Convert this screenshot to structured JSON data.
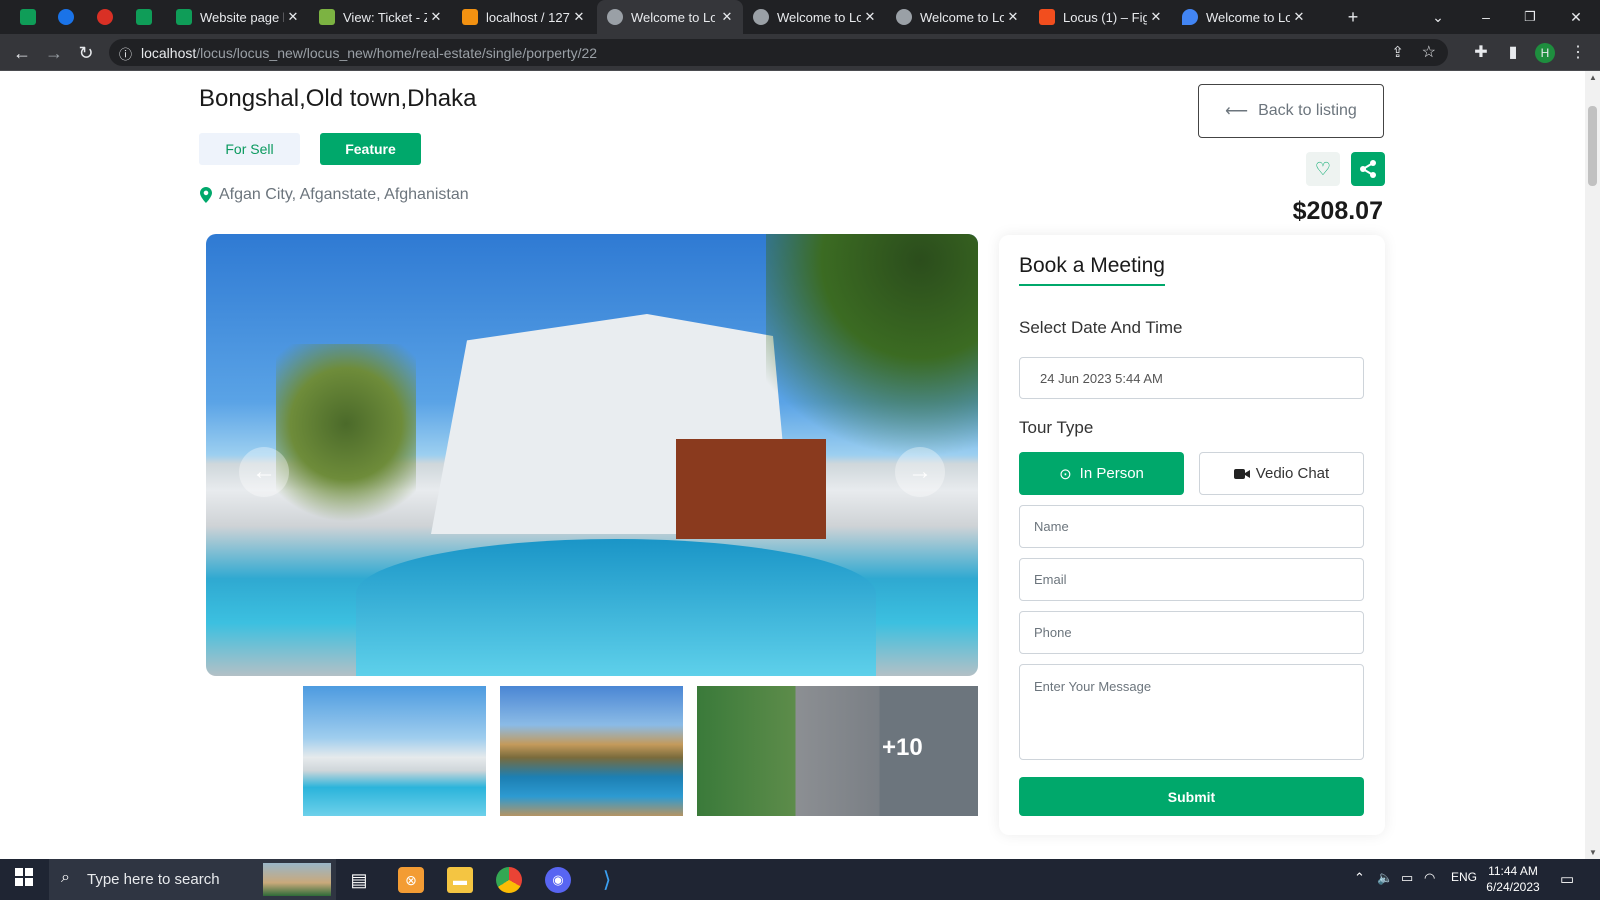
{
  "browser": {
    "tabs": [
      {
        "title": "",
        "favicon_color": "#0f9d58"
      },
      {
        "title": "",
        "favicon_color": "#1a73e8"
      },
      {
        "title": "",
        "favicon_color": "#d93025"
      },
      {
        "title": "",
        "favicon_color": "#0f9d58"
      },
      {
        "title": "Website page li",
        "favicon_color": "#0f9d58"
      },
      {
        "title": "View: Ticket - Z",
        "favicon_color": "#7cb342"
      },
      {
        "title": "localhost / 127.",
        "favicon_color": "#f29111"
      },
      {
        "title": "Welcome to Lo",
        "favicon_color": "#9aa0a6",
        "active": true
      },
      {
        "title": "Welcome to Lo",
        "favicon_color": "#9aa0a6"
      },
      {
        "title": "Welcome to Lo",
        "favicon_color": "#9aa0a6"
      },
      {
        "title": "Locus (1) – Figm",
        "favicon_color": "#f24e1e"
      },
      {
        "title": "Welcome to Lo",
        "favicon_color": "#4285f4"
      }
    ],
    "url_host": "localhost",
    "url_path": "/locus/locus_new/locus_new/home/real-estate/single/porperty/22",
    "profile_initial": "H"
  },
  "property": {
    "title": "Bongshal,Old town,Dhaka",
    "badge_sell": "For Sell",
    "badge_feature": "Feature",
    "location": "Afgan City, Afganstate, Afghanistan",
    "back_label": "Back to listing",
    "price": "$208.07",
    "more_photos": "+10"
  },
  "booking": {
    "title": "Book a Meeting",
    "date_label": "Select Date And Time",
    "date_value": "24 Jun 2023 5:44 AM",
    "tour_label": "Tour Type",
    "in_person": "In Person",
    "video_chat": "Vedio Chat",
    "name_placeholder": "Name",
    "email_placeholder": "Email",
    "phone_placeholder": "Phone",
    "message_placeholder": "Enter Your Message",
    "submit": "Submit"
  },
  "taskbar": {
    "search_placeholder": "Type here to search",
    "language": "ENG",
    "time": "11:44 AM",
    "date": "6/24/2023"
  },
  "colors": {
    "accent": "#00a86b",
    "taskbar": "#1f2533"
  }
}
